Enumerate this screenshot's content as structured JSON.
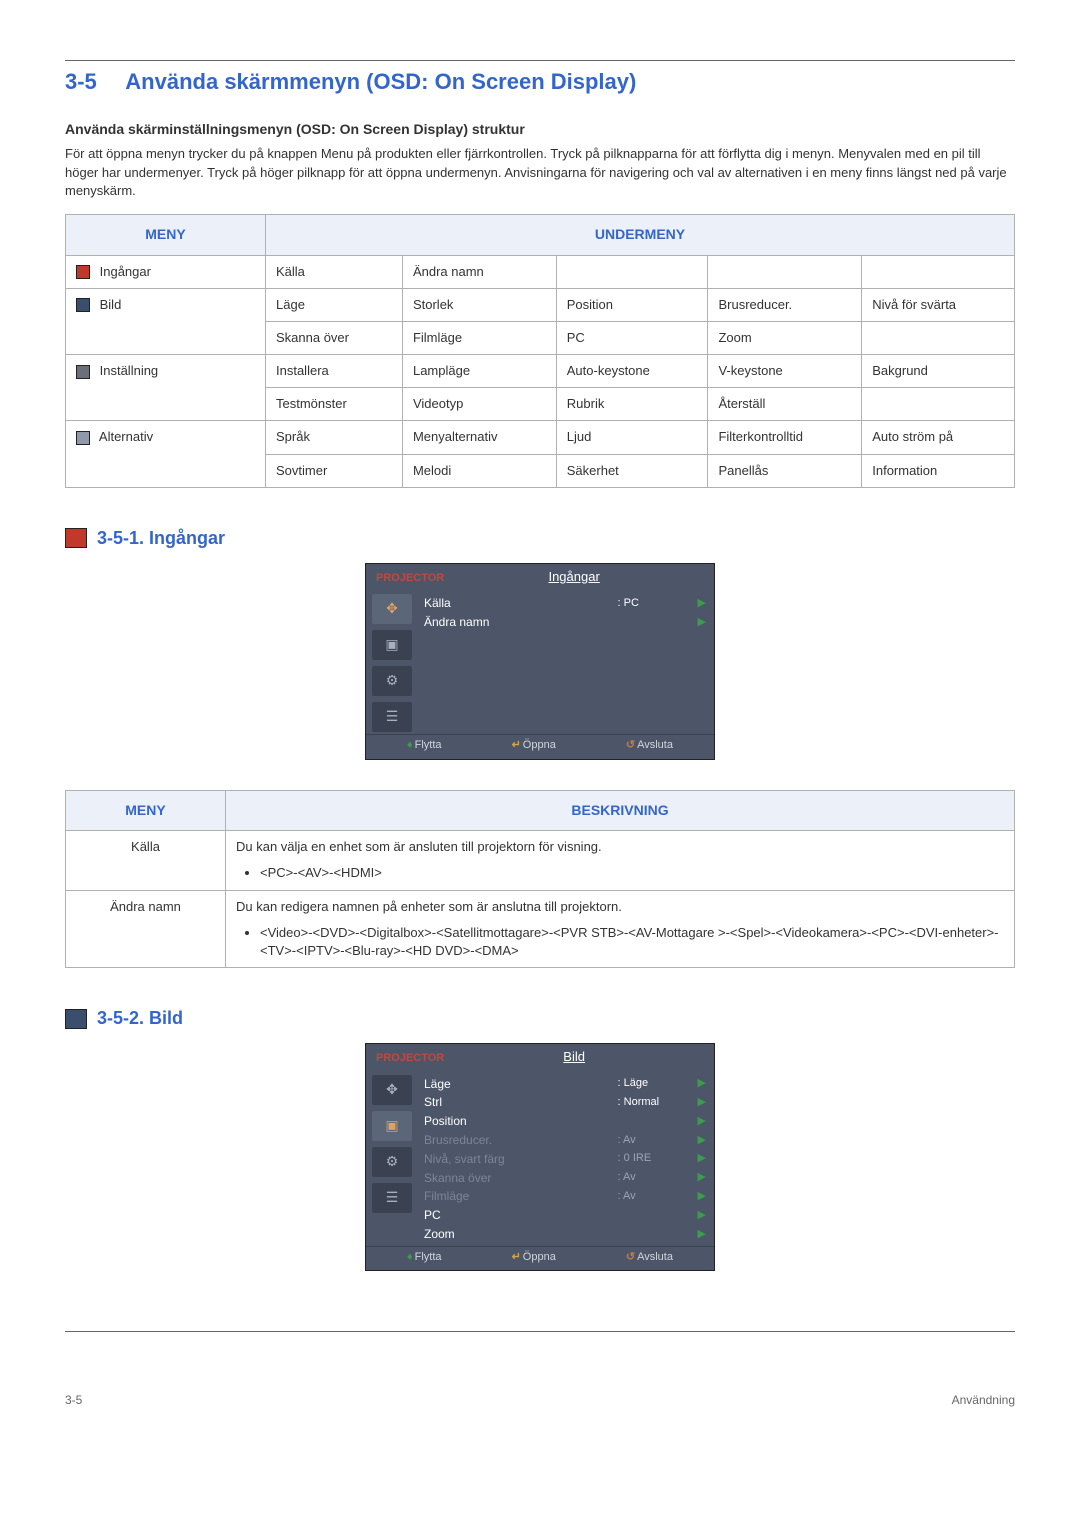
{
  "heading": {
    "num": "3-5",
    "title": "Använda skärmmenyn (OSD: On Screen Display)"
  },
  "sub": "Använda skärminställningsmenyn (OSD: On Screen Display) struktur",
  "para": "För att öppna menyn trycker du på knappen Menu på produkten eller fjärrkontrollen. Tryck på pilknapparna för att förflytta dig i menyn. Menyvalen med en pil till höger har undermenyer. Tryck på höger pilknapp för att öppna undermenyn. Anvisningarna för navigering och val av alternativen i en meny finns längst ned på varje menyskärm.",
  "menuTable": {
    "head": {
      "c1": "MENY",
      "c2": "UNDERMENY"
    },
    "rows": [
      {
        "menu": "Ingångar",
        "cells": [
          "Källa",
          "Ändra namn",
          "",
          "",
          ""
        ]
      },
      {
        "menu": "Bild",
        "cells": [
          "Läge",
          "Storlek",
          "Position",
          "Brusreducer.",
          "Nivå för svärta"
        ]
      },
      {
        "menu": "",
        "cells": [
          "Skanna över",
          "Filmläge",
          "PC",
          "Zoom",
          ""
        ]
      },
      {
        "menu": "Inställning",
        "cells": [
          "Installera",
          "Lampläge",
          "Auto-keystone",
          "V-keystone",
          "Bakgrund"
        ]
      },
      {
        "menu": "",
        "cells": [
          "Testmönster",
          "Videotyp",
          "Rubrik",
          "Återställ",
          ""
        ]
      },
      {
        "menu": "Alternativ",
        "cells": [
          "Språk",
          "Menyalternativ",
          "Ljud",
          "Filterkontrolltid",
          "Auto ström på"
        ]
      },
      {
        "menu": "",
        "cells": [
          "Sovtimer",
          "Melodi",
          "Säkerhet",
          "Panellås",
          "Information"
        ]
      }
    ]
  },
  "sec1": {
    "num": "3-5-1.",
    "title": "Ingångar"
  },
  "osd1": {
    "brand": "PROJECTOR",
    "title": "Ingångar",
    "rows": [
      {
        "label": "Källa",
        "val": ": PC",
        "arrow": "▶",
        "active": true
      },
      {
        "label": "Ändra namn",
        "val": "",
        "arrow": "▶",
        "active": true
      }
    ],
    "footer": {
      "move": "Flytta",
      "open": "Öppna",
      "exit": "Avsluta"
    }
  },
  "descTable": {
    "head": {
      "c1": "MENY",
      "c2": "BESKRIVNING"
    },
    "r1": {
      "menu": "Källa",
      "text": "Du kan välja en enhet som är ansluten till projektorn för visning.",
      "bullet": "<PC>-<AV>-<HDMI>"
    },
    "r2": {
      "menu": "Ändra namn",
      "text": "Du kan redigera namnen på enheter som är anslutna till projektorn.",
      "bullet": "<Video>-<DVD>-<Digitalbox>-<Satellitmottagare>-<PVR STB>-<AV-Mottagare >-<Spel>-<Videokamera>-<PC>-<DVI-enheter>-<TV>-<IPTV>-<Blu-ray>-<HD DVD>-<DMA>"
    }
  },
  "sec2": {
    "num": "3-5-2.",
    "title": "Bild"
  },
  "osd2": {
    "brand": "PROJECTOR",
    "title": "Bild",
    "rows": [
      {
        "label": "Läge",
        "val": ": Läge",
        "arrow": "▶",
        "active": true
      },
      {
        "label": "Strl",
        "val": ": Normal",
        "arrow": "▶",
        "active": true
      },
      {
        "label": "Position",
        "val": "",
        "arrow": "▶",
        "active": true
      },
      {
        "label": "Brusreducer.",
        "val": ": Av",
        "arrow": "▶",
        "dim": true
      },
      {
        "label": "Nivå, svart färg",
        "val": ": 0 IRE",
        "arrow": "▶",
        "dim": true
      },
      {
        "label": "Skanna över",
        "val": ": Av",
        "arrow": "▶",
        "dim": true
      },
      {
        "label": "Filmläge",
        "val": ": Av",
        "arrow": "▶",
        "dim": true
      },
      {
        "label": "PC",
        "val": "",
        "arrow": "▶",
        "active": true
      },
      {
        "label": "Zoom",
        "val": "",
        "arrow": "▶",
        "active": true
      }
    ],
    "footer": {
      "move": "Flytta",
      "open": "Öppna",
      "exit": "Avsluta"
    }
  },
  "footer": {
    "left": "3-5",
    "right": "Användning"
  }
}
